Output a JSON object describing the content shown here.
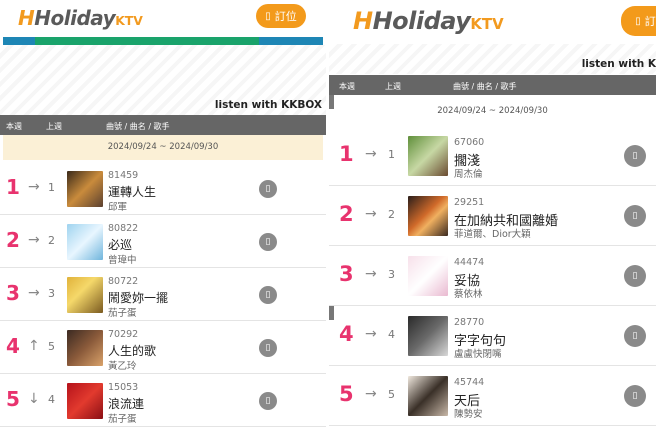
{
  "brand": {
    "logo_holiday": "Holiday",
    "logo_ktv": "KTV",
    "book_label": "訂位",
    "book_icon": "calendar-icon"
  },
  "colors": {
    "accent_orange": "#f39a1b",
    "rank_pink": "#e8336e",
    "header_gray": "#666666",
    "bar_blue": "#1e86b5",
    "bar_green": "#1aa36b"
  },
  "kkbox_label": "listen with KKBOX",
  "kkbox_label_right": "listen with K",
  "columns": {
    "this_week": "本週",
    "last_week": "上週",
    "song_info": "曲號 / 曲名 / 歌手"
  },
  "date_range": "2024/09/24 ~ 2024/09/30",
  "left_chart": [
    {
      "rank": "1",
      "trend": "→",
      "prev": "1",
      "code": "81459",
      "song": "運轉人生",
      "artist": "邱軍"
    },
    {
      "rank": "2",
      "trend": "→",
      "prev": "2",
      "code": "80822",
      "song": "必巡",
      "artist": "曾瑋中"
    },
    {
      "rank": "3",
      "trend": "→",
      "prev": "3",
      "code": "80722",
      "song": "鬧愛妳一擺",
      "artist": "茄子蛋"
    },
    {
      "rank": "4",
      "trend": "↑",
      "prev": "5",
      "code": "70292",
      "song": "人生的歌",
      "artist": "黃乙玲"
    },
    {
      "rank": "5",
      "trend": "↓",
      "prev": "4",
      "code": "15053",
      "song": "浪流連",
      "artist": "茄子蛋"
    }
  ],
  "right_chart": [
    {
      "rank": "1",
      "trend": "→",
      "prev": "1",
      "code": "67060",
      "song": "擱淺",
      "artist": "周杰倫"
    },
    {
      "rank": "2",
      "trend": "→",
      "prev": "2",
      "code": "29251",
      "song": "在加納共和國離婚",
      "artist": "菲道爾、Dior大穎"
    },
    {
      "rank": "3",
      "trend": "→",
      "prev": "3",
      "code": "44474",
      "song": "妥協",
      "artist": "蔡依林"
    },
    {
      "rank": "4",
      "trend": "→",
      "prev": "4",
      "code": "28770",
      "song": "字字句句",
      "artist": "盧盧快閉嘴"
    },
    {
      "rank": "5",
      "trend": "→",
      "prev": "5",
      "code": "45744",
      "song": "天后",
      "artist": "陳勢安"
    }
  ]
}
